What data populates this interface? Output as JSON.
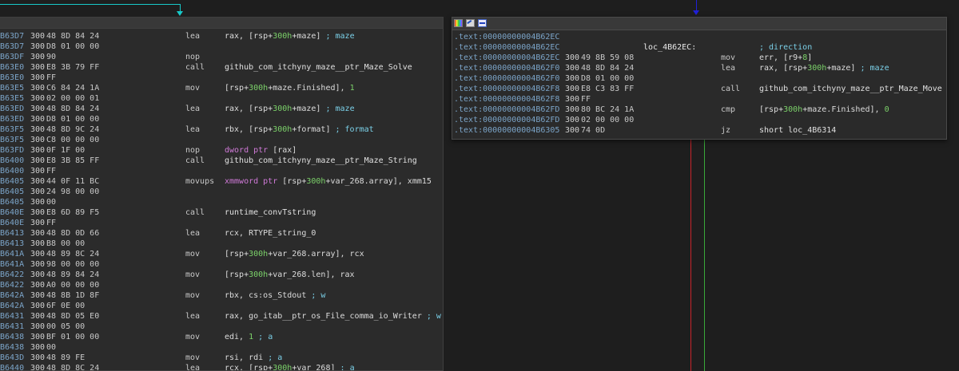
{
  "left_node": {
    "rows": [
      {
        "addr": "B63D7",
        "stk": "300",
        "bytes": "48 8D 84 24",
        "mn": "lea",
        "op": [
          {
            "t": "rax, [rsp+"
          },
          {
            "t": "300h",
            "c": "num"
          },
          {
            "t": "+maze] "
          },
          {
            "t": "; maze",
            "c": "cmt"
          }
        ]
      },
      {
        "addr": "B63D7",
        "stk": "300",
        "bytes": "D8 01 00 00",
        "mn": "",
        "op": []
      },
      {
        "addr": "B63DF",
        "stk": "300",
        "bytes": "90",
        "mn": "nop",
        "op": []
      },
      {
        "addr": "B63E0",
        "stk": "300",
        "bytes": "E8 3B 79 FF",
        "mn": "call",
        "op": [
          {
            "t": "github_com_itchyny_maze__ptr_Maze_Solve",
            "c": "lbl"
          }
        ]
      },
      {
        "addr": "B63E0",
        "stk": "300",
        "bytes": "FF",
        "mn": "",
        "op": []
      },
      {
        "addr": "B63E5",
        "stk": "300",
        "bytes": "C6 84 24 1A",
        "mn": "mov",
        "op": [
          {
            "t": "[rsp+"
          },
          {
            "t": "300h",
            "c": "num"
          },
          {
            "t": "+maze.Finished], "
          },
          {
            "t": "1",
            "c": "num"
          }
        ]
      },
      {
        "addr": "B63E5",
        "stk": "300",
        "bytes": "02 00 00 01",
        "mn": "",
        "op": []
      },
      {
        "addr": "B63ED",
        "stk": "300",
        "bytes": "48 8D 84 24",
        "mn": "lea",
        "op": [
          {
            "t": "rax, [rsp+"
          },
          {
            "t": "300h",
            "c": "num"
          },
          {
            "t": "+maze] "
          },
          {
            "t": "; maze",
            "c": "cmt"
          }
        ]
      },
      {
        "addr": "B63ED",
        "stk": "300",
        "bytes": "D8 01 00 00",
        "mn": "",
        "op": []
      },
      {
        "addr": "B63F5",
        "stk": "300",
        "bytes": "48 8D 9C 24",
        "mn": "lea",
        "op": [
          {
            "t": "rbx, [rsp+"
          },
          {
            "t": "300h",
            "c": "num"
          },
          {
            "t": "+format] "
          },
          {
            "t": "; format",
            "c": "cmt"
          }
        ]
      },
      {
        "addr": "B63F5",
        "stk": "300",
        "bytes": "C8 00 00 00",
        "mn": "",
        "op": []
      },
      {
        "addr": "B63FD",
        "stk": "300",
        "bytes": "0F 1F 00",
        "mn": "nop",
        "op": [
          {
            "t": "dword ptr ",
            "c": "var"
          },
          {
            "t": "[rax]"
          }
        ]
      },
      {
        "addr": "B6400",
        "stk": "300",
        "bytes": "E8 3B 85 FF",
        "mn": "call",
        "op": [
          {
            "t": "github_com_itchyny_maze__ptr_Maze_String",
            "c": "lbl"
          }
        ]
      },
      {
        "addr": "B6400",
        "stk": "300",
        "bytes": "FF",
        "mn": "",
        "op": []
      },
      {
        "addr": "B6405",
        "stk": "300",
        "bytes": "44 0F 11 BC",
        "mn": "movups",
        "op": [
          {
            "t": "xmmword ptr ",
            "c": "var"
          },
          {
            "t": "[rsp+"
          },
          {
            "t": "300h",
            "c": "num"
          },
          {
            "t": "+var_268.array], xmm15"
          }
        ]
      },
      {
        "addr": "B6405",
        "stk": "300",
        "bytes": "24 98 00 00",
        "mn": "",
        "op": []
      },
      {
        "addr": "B6405",
        "stk": "300",
        "bytes": "00",
        "mn": "",
        "op": []
      },
      {
        "addr": "B640E",
        "stk": "300",
        "bytes": "E8 6D 89 F5",
        "mn": "call",
        "op": [
          {
            "t": "runtime_convTstring",
            "c": "lbl"
          }
        ]
      },
      {
        "addr": "B640E",
        "stk": "300",
        "bytes": "FF",
        "mn": "",
        "op": []
      },
      {
        "addr": "B6413",
        "stk": "300",
        "bytes": "48 8D 0D 66",
        "mn": "lea",
        "op": [
          {
            "t": "rcx, RTYPE_string_0"
          }
        ]
      },
      {
        "addr": "B6413",
        "stk": "300",
        "bytes": "B8 00 00",
        "mn": "",
        "op": []
      },
      {
        "addr": "B641A",
        "stk": "300",
        "bytes": "48 89 8C 24",
        "mn": "mov",
        "op": [
          {
            "t": "[rsp+"
          },
          {
            "t": "300h",
            "c": "num"
          },
          {
            "t": "+var_268.array], rcx"
          }
        ]
      },
      {
        "addr": "B641A",
        "stk": "300",
        "bytes": "98 00 00 00",
        "mn": "",
        "op": []
      },
      {
        "addr": "B6422",
        "stk": "300",
        "bytes": "48 89 84 24",
        "mn": "mov",
        "op": [
          {
            "t": "[rsp+"
          },
          {
            "t": "300h",
            "c": "num"
          },
          {
            "t": "+var_268.len], rax"
          }
        ]
      },
      {
        "addr": "B6422",
        "stk": "300",
        "bytes": "A0 00 00 00",
        "mn": "",
        "op": []
      },
      {
        "addr": "B642A",
        "stk": "300",
        "bytes": "48 8B 1D 8F",
        "mn": "mov",
        "op": [
          {
            "t": "rbx, cs:os_Stdout "
          },
          {
            "t": "; w",
            "c": "cmt"
          }
        ]
      },
      {
        "addr": "B642A",
        "stk": "300",
        "bytes": "6F 0E 00",
        "mn": "",
        "op": []
      },
      {
        "addr": "B6431",
        "stk": "300",
        "bytes": "48 8D 05 E0",
        "mn": "lea",
        "op": [
          {
            "t": "rax, go_itab__ptr_os_File_comma_io_Writer "
          },
          {
            "t": "; w",
            "c": "cmt"
          }
        ]
      },
      {
        "addr": "B6431",
        "stk": "300",
        "bytes": "00 05 00",
        "mn": "",
        "op": []
      },
      {
        "addr": "B6438",
        "stk": "300",
        "bytes": "BF 01 00 00",
        "mn": "mov",
        "op": [
          {
            "t": "edi, "
          },
          {
            "t": "1",
            "c": "num"
          },
          {
            "t": " "
          },
          {
            "t": "; a",
            "c": "cmt"
          }
        ]
      },
      {
        "addr": "B6438",
        "stk": "300",
        "bytes": "00",
        "mn": "",
        "op": []
      },
      {
        "addr": "B643D",
        "stk": "300",
        "bytes": "48 89 FE",
        "mn": "mov",
        "op": [
          {
            "t": "rsi, rdi "
          },
          {
            "t": "; a",
            "c": "cmt"
          }
        ]
      },
      {
        "addr": "B6440",
        "stk": "300",
        "bytes": "48 8D 8C 24",
        "mn": "lea",
        "op": [
          {
            "t": "rcx, [rsp+"
          },
          {
            "t": "300h",
            "c": "num"
          },
          {
            "t": "+var_268] "
          },
          {
            "t": "; a",
            "c": "cmt"
          }
        ]
      }
    ]
  },
  "right_node": {
    "rows": [
      {
        "addr": ".text:00000000004B62EC",
        "stk": "",
        "bytes": "",
        "lbl": "",
        "mn": "",
        "op": []
      },
      {
        "addr": ".text:00000000004B62EC",
        "stk": "",
        "bytes": "",
        "lbl": "loc_4B62EC:",
        "mn": "",
        "op": [
          {
            "t": "; direction",
            "c": "cmt"
          }
        ]
      },
      {
        "addr": ".text:00000000004B62EC",
        "stk": "300",
        "bytes": "49 8B 59 08",
        "lbl": "",
        "mn": "mov",
        "op": [
          {
            "t": "err, [r9+"
          },
          {
            "t": "8",
            "c": "num"
          },
          {
            "t": "]"
          }
        ]
      },
      {
        "addr": ".text:00000000004B62F0",
        "stk": "300",
        "bytes": "48 8D 84 24",
        "lbl": "",
        "mn": "lea",
        "op": [
          {
            "t": "rax, [rsp+"
          },
          {
            "t": "300h",
            "c": "num"
          },
          {
            "t": "+maze] "
          },
          {
            "t": "; maze",
            "c": "cmt"
          }
        ]
      },
      {
        "addr": ".text:00000000004B62F0",
        "stk": "300",
        "bytes": "D8 01 00 00",
        "lbl": "",
        "mn": "",
        "op": []
      },
      {
        "addr": ".text:00000000004B62F8",
        "stk": "300",
        "bytes": "E8 C3 83 FF",
        "lbl": "",
        "mn": "call",
        "op": [
          {
            "t": "github_com_itchyny_maze__ptr_Maze_Move",
            "c": "lbl"
          }
        ]
      },
      {
        "addr": ".text:00000000004B62F8",
        "stk": "300",
        "bytes": "FF",
        "lbl": "",
        "mn": "",
        "op": []
      },
      {
        "addr": ".text:00000000004B62FD",
        "stk": "300",
        "bytes": "80 BC 24 1A",
        "lbl": "",
        "mn": "cmp",
        "op": [
          {
            "t": "[rsp+"
          },
          {
            "t": "300h",
            "c": "num"
          },
          {
            "t": "+maze.Finished], "
          },
          {
            "t": "0",
            "c": "num"
          }
        ]
      },
      {
        "addr": ".text:00000000004B62FD",
        "stk": "300",
        "bytes": "02 00 00 00",
        "lbl": "",
        "mn": "",
        "op": []
      },
      {
        "addr": ".text:00000000004B6305",
        "stk": "300",
        "bytes": "74 0D",
        "lbl": "",
        "mn": "jz",
        "op": [
          {
            "t": "short loc_4B6314",
            "c": "lbl"
          }
        ]
      }
    ]
  },
  "colors": {
    "true_edge": "#3aaa3a",
    "false_edge": "#c8242a",
    "flow_edge": "#18c9c9",
    "jump_edge": "#2020d8"
  },
  "icons": [
    "color-palette-icon",
    "edit-graph-icon",
    "node-graph-icon"
  ]
}
